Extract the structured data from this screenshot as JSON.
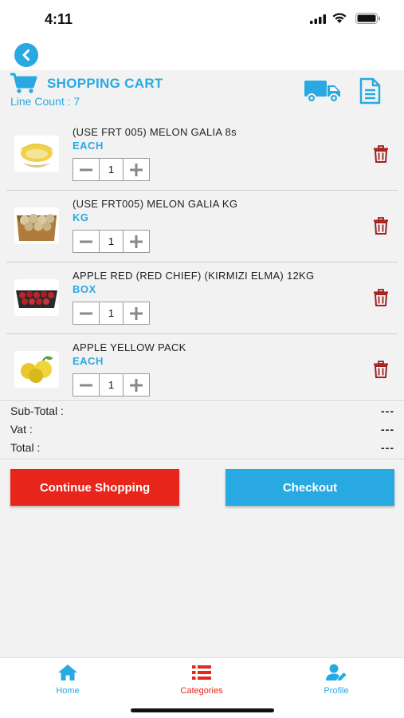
{
  "status_bar": {
    "time": "4:11"
  },
  "header": {
    "title": "SHOPPING CART",
    "line_count": "Line Count : 7"
  },
  "items": [
    {
      "name": "(USE FRT 005) MELON GALIA 8s",
      "unit": "EACH",
      "quantity": "1",
      "thumbnail": "melon-slice"
    },
    {
      "name": "(USE FRT005) MELON GALIA KG",
      "unit": "KG",
      "quantity": "1",
      "thumbnail": "melon-box"
    },
    {
      "name": "APPLE RED (RED CHIEF) (KIRMIZI ELMA) 12KG",
      "unit": "BOX",
      "quantity": "1",
      "thumbnail": "red-apple-tray"
    },
    {
      "name": "APPLE YELLOW PACK",
      "unit": "EACH",
      "quantity": "1",
      "thumbnail": "yellow-apples"
    }
  ],
  "totals": {
    "subtotal_label": "Sub-Total :",
    "subtotal_value": "---",
    "vat_label": "Vat :",
    "vat_value": "---",
    "total_label": "Total :",
    "total_value": "---"
  },
  "actions": {
    "continue_label": "Continue Shopping",
    "checkout_label": "Checkout"
  },
  "tab_bar": {
    "tabs": [
      {
        "label": "Home",
        "icon": "home-icon"
      },
      {
        "label": "Categories",
        "icon": "list-icon"
      },
      {
        "label": "Profile",
        "icon": "user-edit-icon"
      }
    ]
  },
  "colors": {
    "accent_blue": "#29a9e1",
    "accent_red": "#e8251b",
    "trash_red": "#a31f1f",
    "background": "#f2f2f2"
  }
}
